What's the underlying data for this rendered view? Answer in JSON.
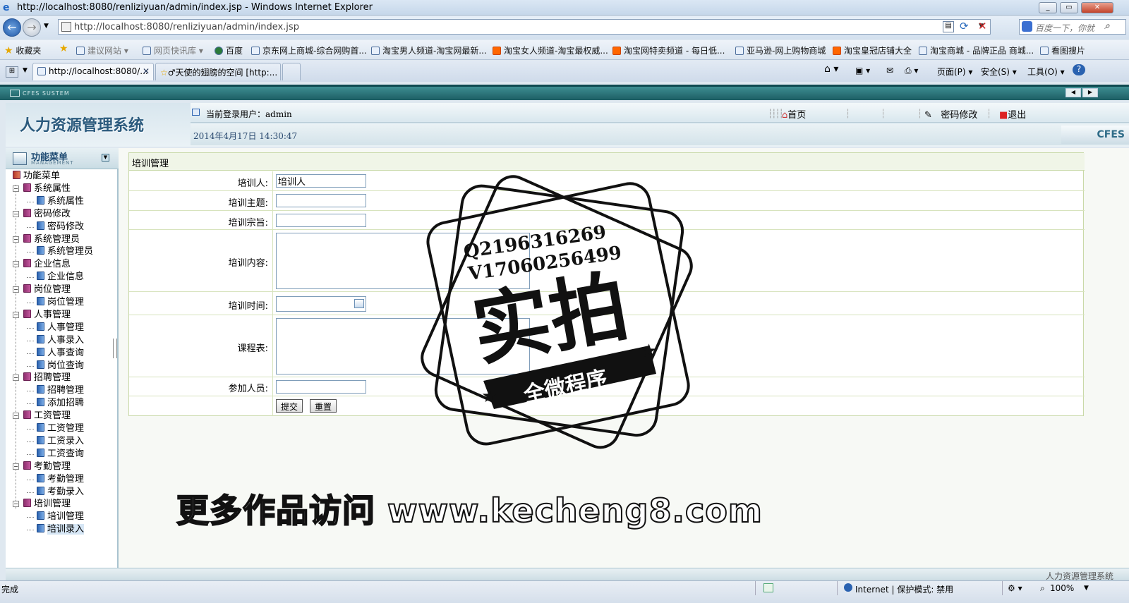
{
  "window": {
    "title": "http://localhost:8080/renliziyuan/admin/index.jsp - Windows Internet Explorer"
  },
  "address": {
    "url": "http://localhost:8080/renliziyuan/admin/index.jsp",
    "search_placeholder": "百度一下，你就"
  },
  "favorites": {
    "label": "收藏夹",
    "items": [
      "建议网站 ▾",
      "网页快讯库 ▾",
      "百度",
      "京东网上商城-综合网购首...",
      "淘宝男人频道-淘宝网最新...",
      "淘宝女人频道-淘宝最权威...",
      "淘宝网特卖频道 - 每日低...",
      "亚马逊-网上购物商城",
      "淘宝皇冠店铺大全",
      "淘宝商城 - 品牌正品 商城...",
      "看图搜片"
    ]
  },
  "tabs": [
    {
      "label": "http://localhost:8080/..."
    },
    {
      "label": "♂天使的翅膀的空间 [http:..."
    }
  ],
  "commandbar": {
    "page": "页面(P) ▾",
    "safety": "安全(S) ▾",
    "tools": "工具(O) ▾",
    "help": "?"
  },
  "app": {
    "brand_bar": "CFES SUSTEM",
    "title": "人力资源管理系统",
    "current_user": "当前登录用户：admin",
    "date": "2014年4月17日  14:30:47",
    "home": "首页",
    "change_password": "密码修改",
    "logout": "退出",
    "logo": "CFES",
    "footer": "人力资源管理系统"
  },
  "menu": {
    "title": "功能菜单",
    "subtitle": "MANAGEMENT",
    "root": "功能菜单",
    "groups": [
      {
        "label": "系统属性",
        "items": [
          "系统属性"
        ]
      },
      {
        "label": "密码修改",
        "items": [
          "密码修改"
        ]
      },
      {
        "label": "系统管理员",
        "items": [
          "系统管理员"
        ]
      },
      {
        "label": "企业信息",
        "items": [
          "企业信息"
        ]
      },
      {
        "label": "岗位管理",
        "items": [
          "岗位管理"
        ]
      },
      {
        "label": "人事管理",
        "items": [
          "人事管理",
          "人事录入",
          "人事查询",
          "岗位查询"
        ]
      },
      {
        "label": "招聘管理",
        "items": [
          "招聘管理",
          "添加招聘"
        ]
      },
      {
        "label": "工资管理",
        "items": [
          "工资管理",
          "工资录入",
          "工资查询"
        ]
      },
      {
        "label": "考勤管理",
        "items": [
          "考勤管理",
          "考勤录入"
        ]
      },
      {
        "label": "培训管理",
        "items": [
          "培训管理",
          "培训录入"
        ]
      }
    ]
  },
  "form": {
    "title": "培训管理",
    "trainer_label": "培训人:",
    "trainer_value": "培训人",
    "topic_label": "培训主题:",
    "purpose_label": "培训宗旨:",
    "content_label": "培训内容:",
    "time_label": "培训时间:",
    "schedule_label": "课程表:",
    "participants_label": "参加人员:",
    "submit": "提交",
    "reset": "重置"
  },
  "stamp": {
    "line1": "Q2196316269",
    "line2": "V17060256499",
    "big": "实拍",
    "ribbon": "全微程序"
  },
  "watermark": "更多作品访问 www.kecheng8.com",
  "statusbar": {
    "left": "完成",
    "zone": "Internet | 保护模式: 禁用",
    "zoom": "100%"
  }
}
